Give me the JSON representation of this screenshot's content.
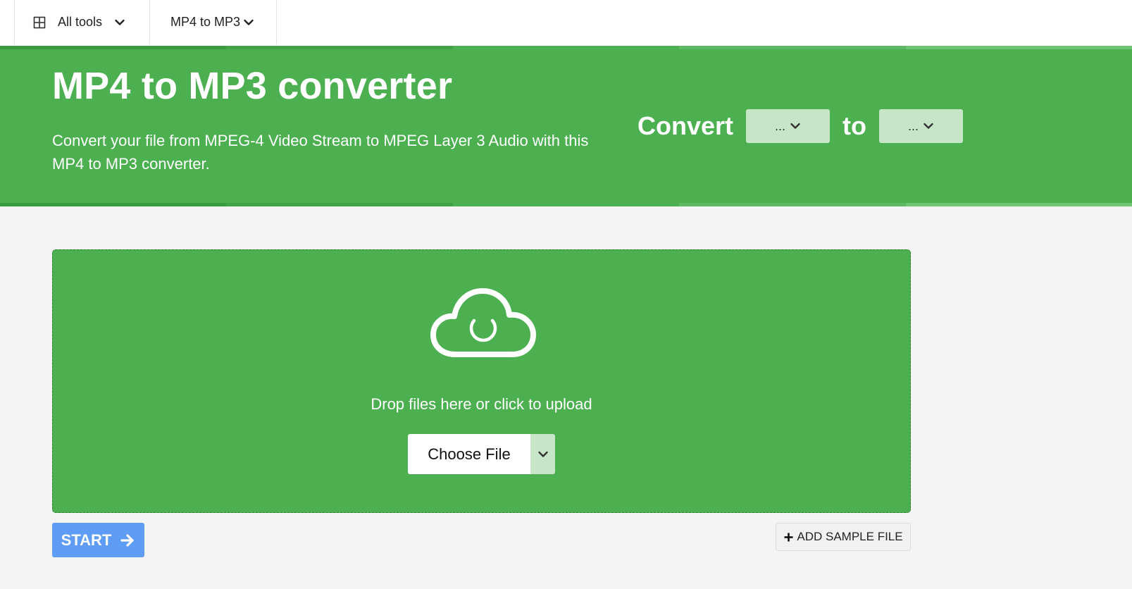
{
  "nav": {
    "all_tools_label": "All tools",
    "all_tools_icon": "grid-icon",
    "format_label": "MP4 to MP3"
  },
  "hero": {
    "title": "MP4 to MP3 converter",
    "description": "Convert your file from MPEG-4 Video Stream to MPEG Layer 3 Audio with this MP4 to MP3 converter.",
    "convert_label": "Convert",
    "to_label": "to",
    "from_select_value": "...",
    "to_select_value": "..."
  },
  "upload": {
    "icon": "cloud-upload-icon",
    "drop_text": "Drop files here or click to upload",
    "choose_file_label": "Choose File"
  },
  "actions": {
    "start_label": "START",
    "add_sample_label": "ADD SAMPLE FILE"
  },
  "colors": {
    "brand_green": "#4caf50",
    "light_green": "#c7e6c8",
    "start_blue": "#5e9cf5",
    "page_background": "#f4f4f4"
  }
}
